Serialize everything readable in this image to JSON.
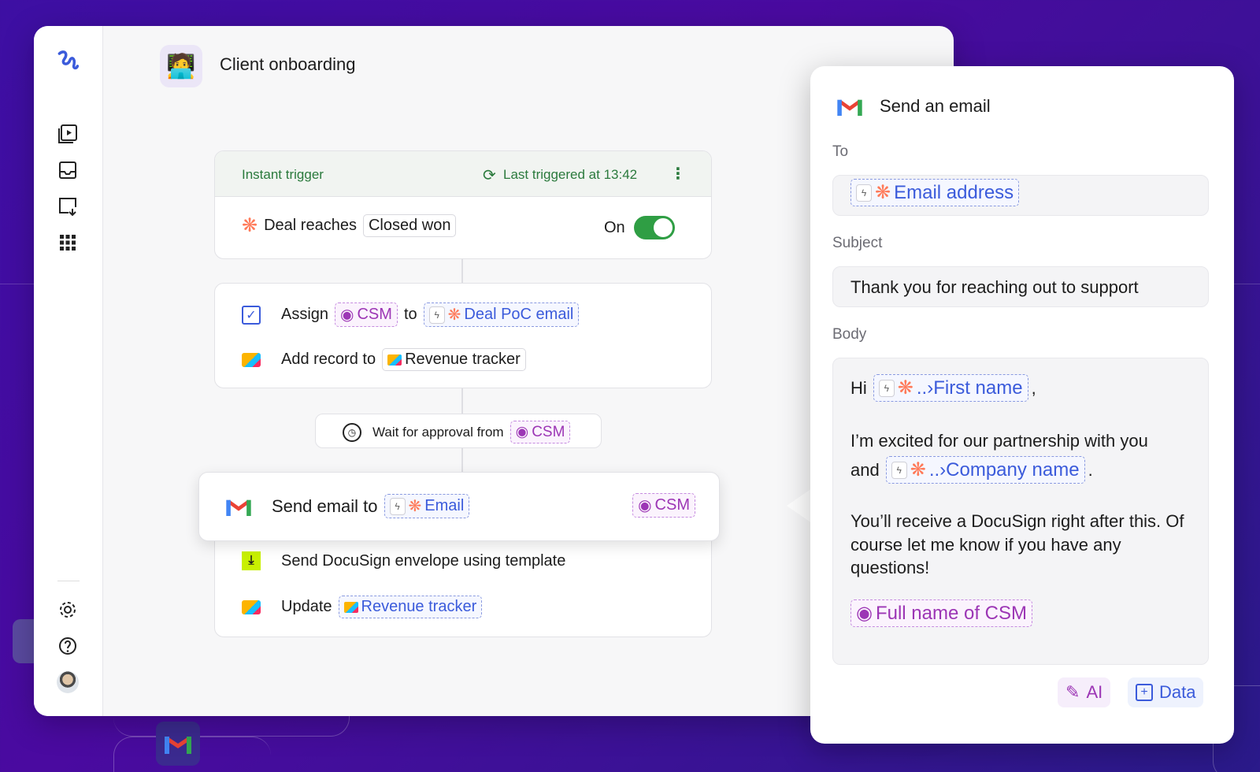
{
  "workflow": {
    "title": "Client onboarding",
    "trigger": {
      "label": "Instant trigger",
      "last_triggered": "Last triggered at 13:42",
      "text": "Deal reaches",
      "value": "Closed won",
      "toggle_label": "On",
      "toggle_on": true
    },
    "actions": {
      "assign": "Assign",
      "assign_token": "CSM",
      "to": "to",
      "deal_poc": "Deal PoC email",
      "add_record": "Add record to",
      "revenue_tracker": "Revenue tracker"
    },
    "wait": {
      "text": "Wait for approval from",
      "token": "CSM"
    },
    "send_email": {
      "text": "Send email to",
      "token": "Email",
      "owner": "CSM"
    },
    "docusign": {
      "text": "Send DocuSign envelope using template"
    },
    "update": {
      "text": "Update",
      "token": "Revenue tracker"
    }
  },
  "panel": {
    "title": "Send an email",
    "to_label": "To",
    "to_token": "Email address",
    "subject_label": "Subject",
    "subject_value": "Thank you for reaching out to support",
    "body_label": "Body",
    "body": {
      "hi": "Hi",
      "first_name": "..›First name",
      "comma": ",",
      "line2": "I’m excited for our partnership with you",
      "and": "and",
      "company_name": "..›Company name",
      "period": ".",
      "line3": "You’ll receive a DocuSign right after this. Of course let me know if you have any questions!",
      "signature": "Full name of CSM"
    },
    "ai_button": "AI",
    "data_button": "Data"
  },
  "colors": {
    "hubspot": "#ff7a59",
    "token_blue": "#3b5bdb",
    "token_purple": "#9c36b5",
    "toggle_green": "#2f9e44",
    "trigger_green": "#2b7a3d"
  }
}
